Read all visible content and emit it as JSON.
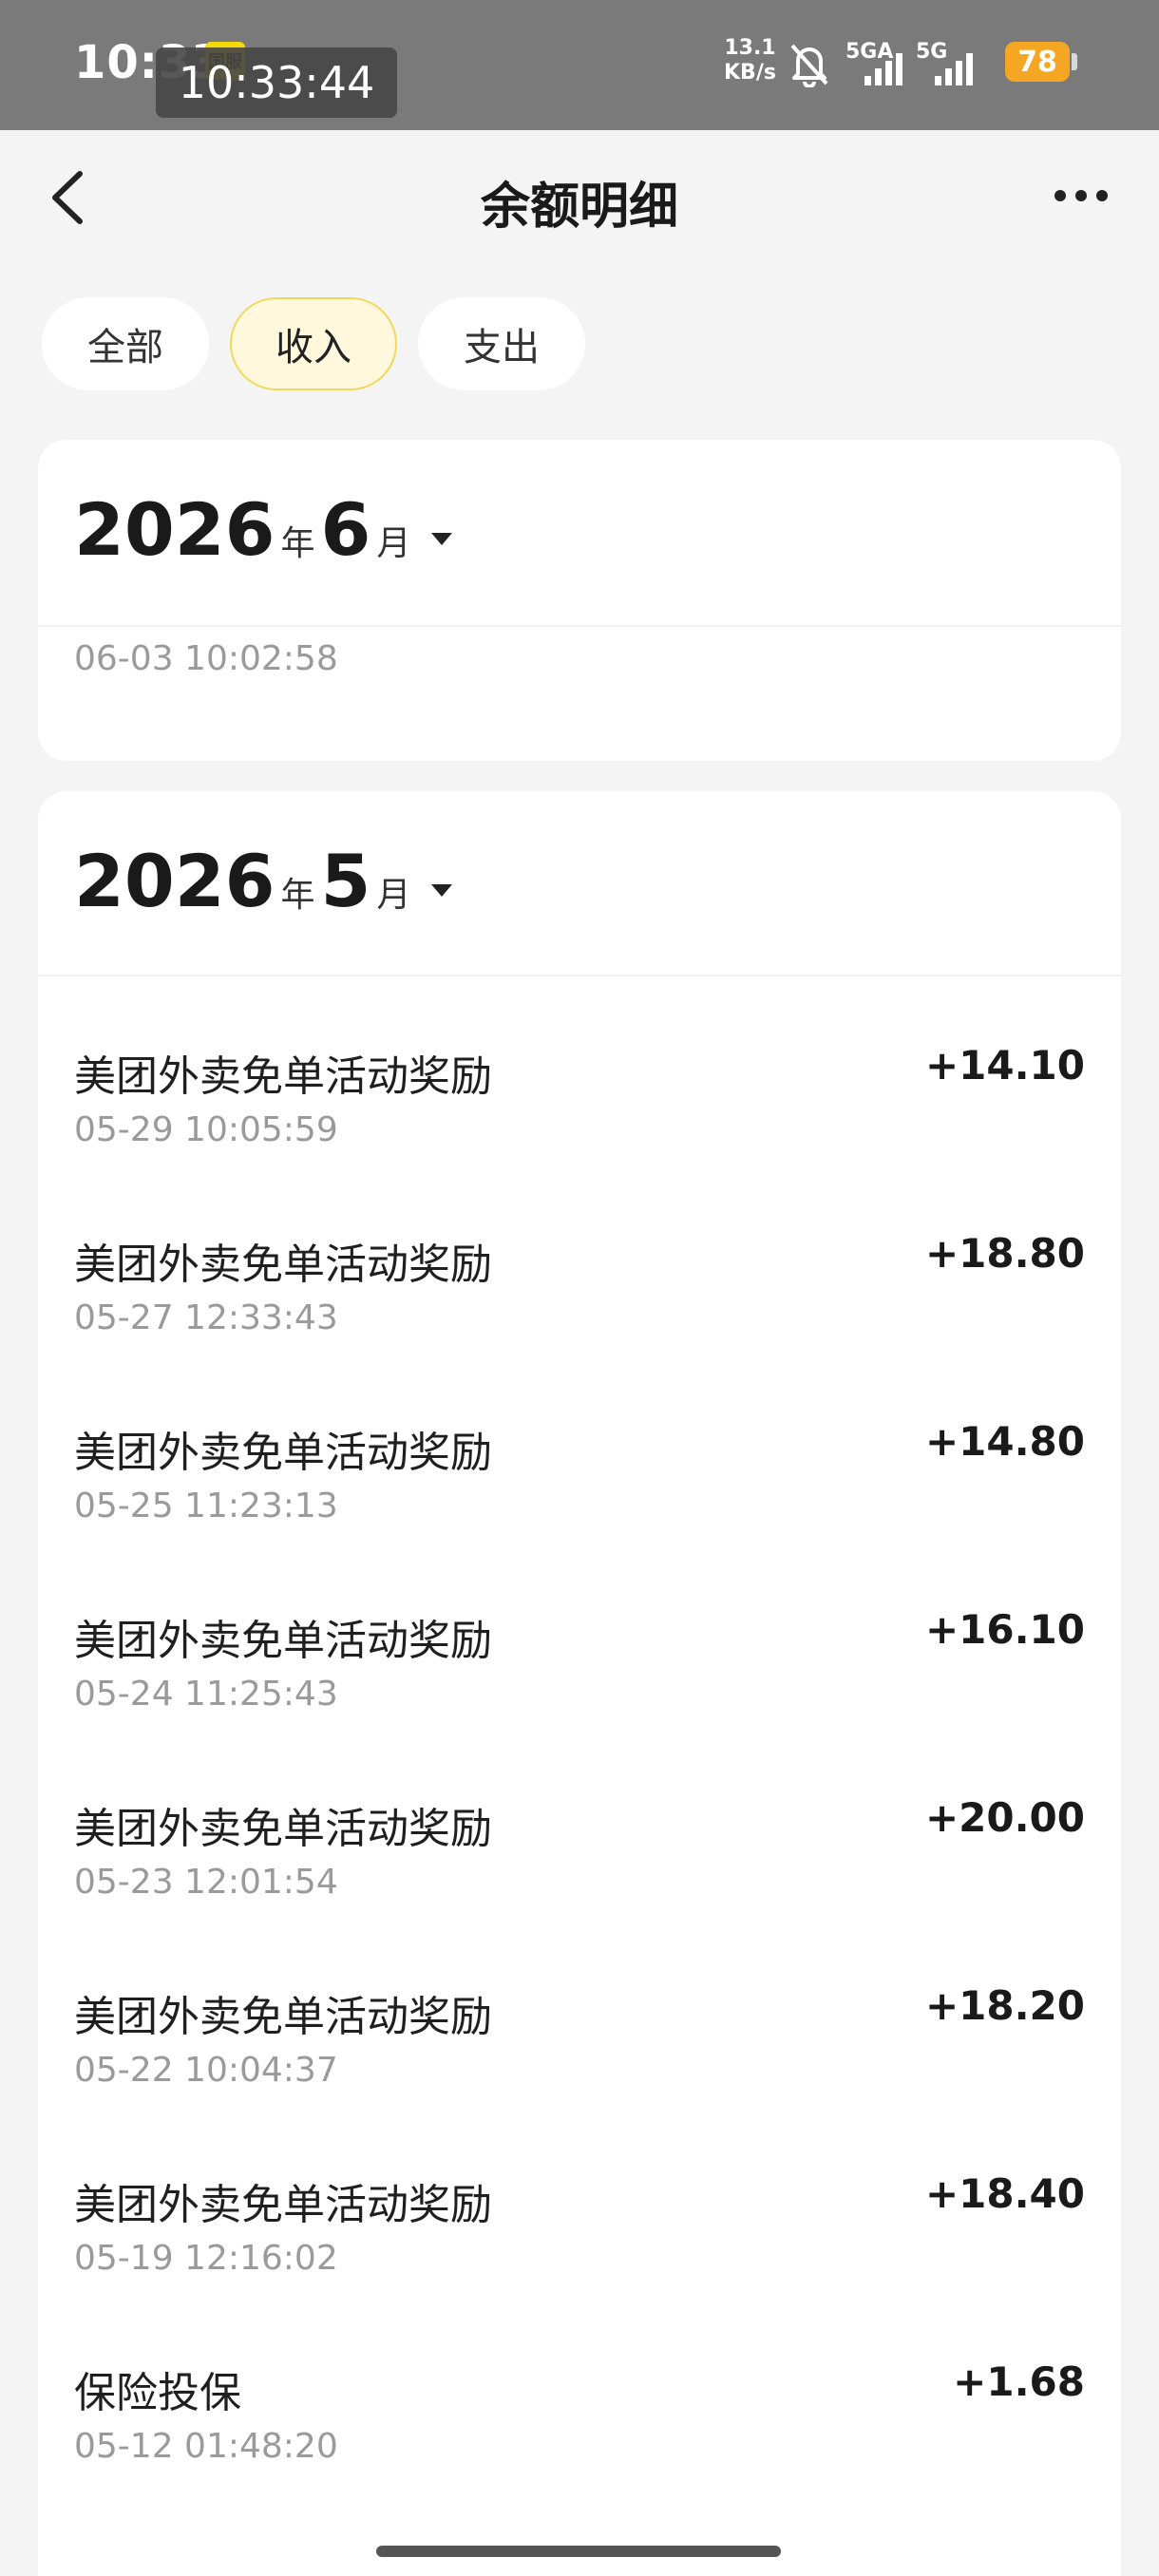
{
  "status_bar": {
    "time": "10:33",
    "badge": "国服",
    "overlay_clock": "10:33:44",
    "net_speed_value": "13.1",
    "net_speed_unit": "KB/s",
    "sim1_label": "5GA",
    "sim2_label": "5G",
    "battery": "78"
  },
  "header": {
    "title": "余额明细",
    "back_icon": "back-chevron-icon",
    "more_icon": "more-dots-icon"
  },
  "filters": [
    {
      "label": "全部",
      "active": false
    },
    {
      "label": "收入",
      "active": true
    },
    {
      "label": "支出",
      "active": false
    }
  ],
  "months": [
    {
      "year": "2026",
      "year_unit": "年",
      "month": "6",
      "month_unit": "月",
      "records": [
        {
          "title": "",
          "time": "06-03 10:02:58",
          "amount": ""
        }
      ]
    },
    {
      "year": "2026",
      "year_unit": "年",
      "month": "5",
      "month_unit": "月",
      "records": [
        {
          "title": "美团外卖免单活动奖励",
          "time": "05-29 10:05:59",
          "amount": "+14.10"
        },
        {
          "title": "美团外卖免单活动奖励",
          "time": "05-27 12:33:43",
          "amount": "+18.80"
        },
        {
          "title": "美团外卖免单活动奖励",
          "time": "05-25 11:23:13",
          "amount": "+14.80"
        },
        {
          "title": "美团外卖免单活动奖励",
          "time": "05-24 11:25:43",
          "amount": "+16.10"
        },
        {
          "title": "美团外卖免单活动奖励",
          "time": "05-23 12:01:54",
          "amount": "+20.00"
        },
        {
          "title": "美团外卖免单活动奖励",
          "time": "05-22 10:04:37",
          "amount": "+18.20"
        },
        {
          "title": "美团外卖免单活动奖励",
          "time": "05-19 12:16:02",
          "amount": "+18.40"
        },
        {
          "title": "保险投保",
          "time": "05-12 01:48:20",
          "amount": "+1.68"
        }
      ]
    }
  ],
  "colors": {
    "accent_chip_bg": "#fff8dc",
    "accent_chip_border": "#f0d95a",
    "battery": "#f5a623",
    "status_bar_bg": "#7a7a7a",
    "page_bg": "#f4f4f4"
  }
}
